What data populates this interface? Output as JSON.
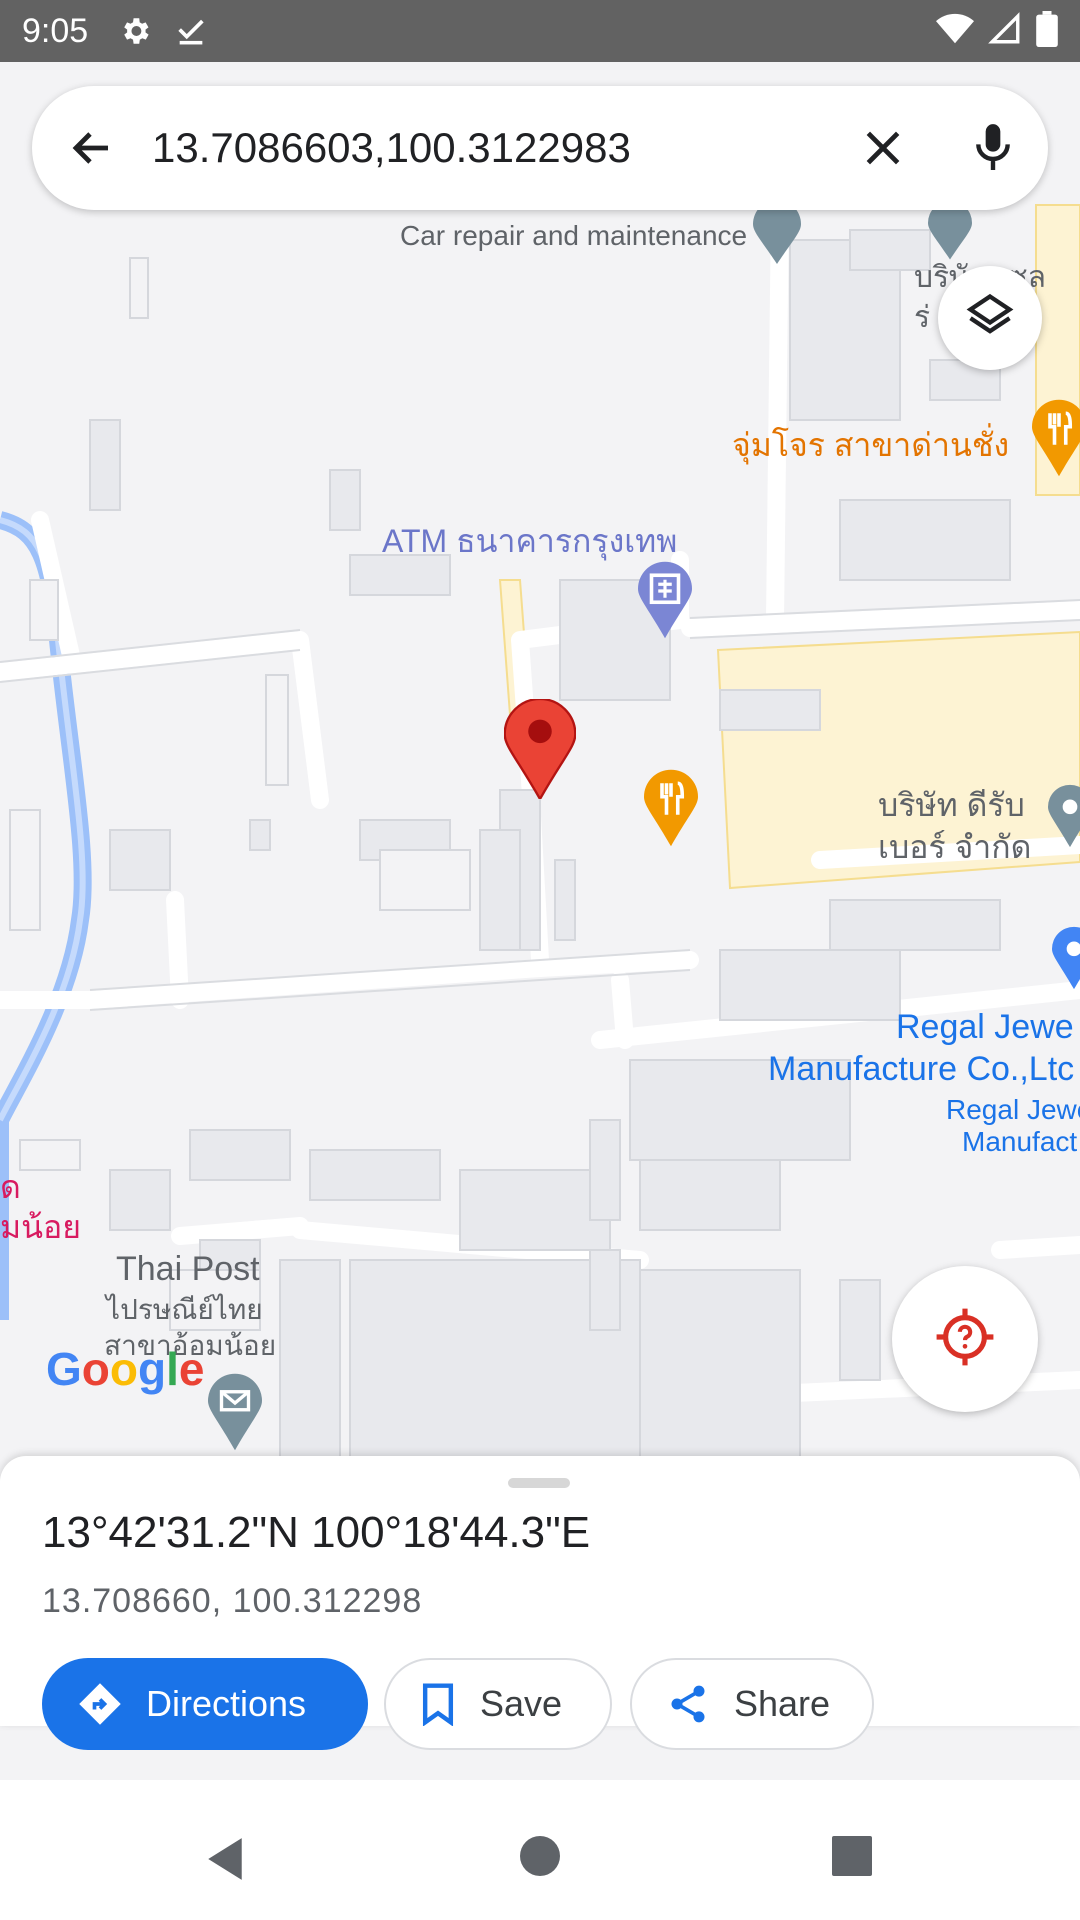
{
  "status_bar": {
    "time": "9:05"
  },
  "search": {
    "query": "13.7086603,100.3122983"
  },
  "map": {
    "labels": {
      "car_repair": "Car repair and maintenance",
      "company_sel_1": "บริษัท เซล",
      "company_sel_2": "ร่ ดิ้ง",
      "jumchor": "จุ่มโจร สาขาด่านชั่ง",
      "atm": "ATM ธนาคารกรุงเทพ",
      "derub_1": "บริษัท ดีรับ",
      "derub_2": "เบอร์ จำกัด",
      "regal_1": "Regal Jewe",
      "regal_2": "Manufacture Co.,Ltc",
      "regal_small_1": "Regal Jewe",
      "regal_small_2": "Manufact",
      "temple_1": "ด",
      "temple_2": "มน้อย",
      "thai_post": "Thai Post",
      "thai_post_th1": "ไปรษณีย์ไทย",
      "thai_post_th2": "สาขาอ้อมน้อย"
    },
    "logo": "Google",
    "colors": {
      "pin": "#ea4335",
      "food": "#f29900",
      "atm": "#7b86d4",
      "link": "#1a73e8",
      "water": "#9cc0f9"
    }
  },
  "place_sheet": {
    "dms": "13°42'31.2\"N 100°18'44.3\"E",
    "decimal": "13.708660, 100.312298",
    "buttons": {
      "directions": "Directions",
      "save": "Save",
      "share": "Share"
    }
  }
}
